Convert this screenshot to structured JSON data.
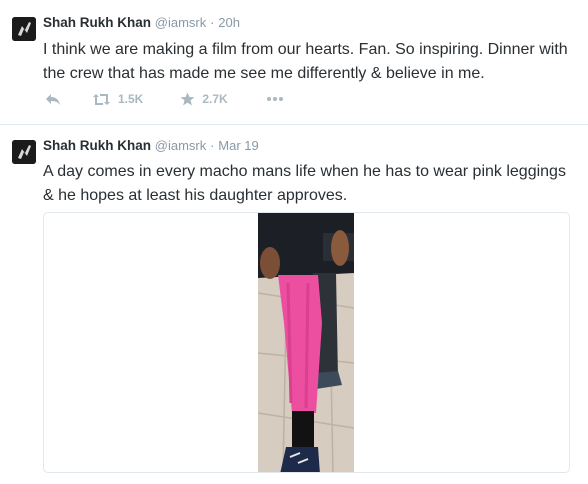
{
  "tweets": [
    {
      "name": "Shah Rukh Khan",
      "handle": "@iamsrk",
      "separator": "·",
      "time": "20h",
      "text": "I think we are making a film from our hearts. Fan. So inspiring. Dinner with the crew that has made me see me differently & believe in me.",
      "retweets": "1.5K",
      "favorites": "2.7K"
    },
    {
      "name": "Shah Rukh Khan",
      "handle": "@iamsrk",
      "separator": "·",
      "time": "Mar 19",
      "text": "A day comes in every macho mans life when he has to wear pink leggings & he hopes at least his daughter approves."
    }
  ],
  "colors": {
    "text": "#292f33",
    "muted": "#8899a6",
    "action_icon": "#aab8c2",
    "divider": "#e1e8ed",
    "legging_pink": "#ec4fa0"
  },
  "icons": {
    "avatar": "avatar-image",
    "reply": "reply-icon",
    "retweet": "retweet-icon",
    "favorite": "star-icon",
    "more": "more-dots-icon"
  }
}
